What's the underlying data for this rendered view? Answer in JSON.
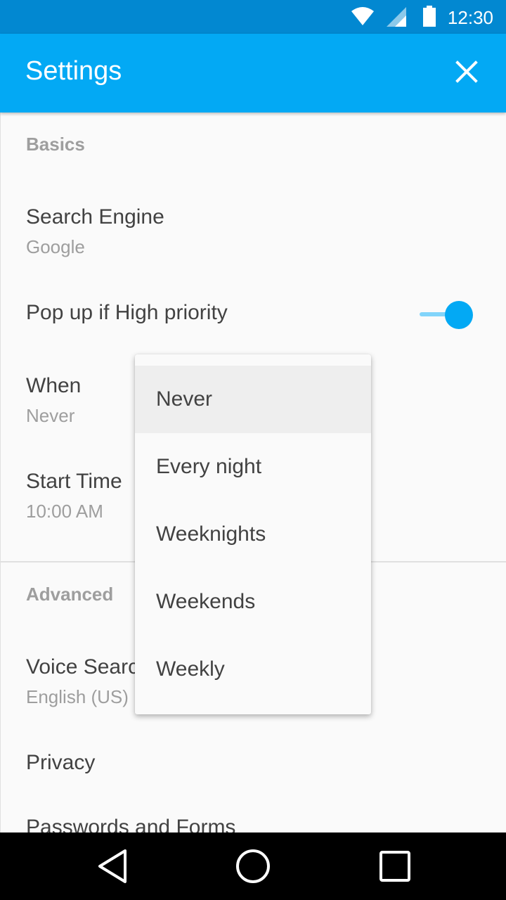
{
  "status_bar": {
    "time": "12:30",
    "icons": [
      "wifi-icon",
      "cell-signal-icon",
      "battery-icon"
    ]
  },
  "app_bar": {
    "title": "Settings",
    "close_icon": "close-icon",
    "color": "#03a9f4"
  },
  "sections": {
    "basics": {
      "header": "Basics",
      "search_engine": {
        "title": "Search Engine",
        "summary": "Google"
      },
      "popup": {
        "title": "Pop up if High priority",
        "switch_on": true
      },
      "when": {
        "title": "When",
        "summary": "Never"
      },
      "start_time": {
        "title": "Start Time",
        "summary": "10:00 AM"
      }
    },
    "advanced": {
      "header": "Advanced",
      "voice_search": {
        "title": "Voice Search",
        "summary": "English (US)"
      },
      "privacy": {
        "title": "Privacy"
      },
      "passwords": {
        "title": "Passwords and Forms"
      }
    }
  },
  "dropdown": {
    "selected": "Never",
    "options": [
      "Never",
      "Every night",
      "Weeknights",
      "Weekends",
      "Weekly"
    ]
  },
  "nav_bar": {
    "icons": [
      "back-icon",
      "home-icon",
      "recents-icon"
    ]
  },
  "colors": {
    "accent": "#03a9f4",
    "status_bar": "#0288d1"
  }
}
